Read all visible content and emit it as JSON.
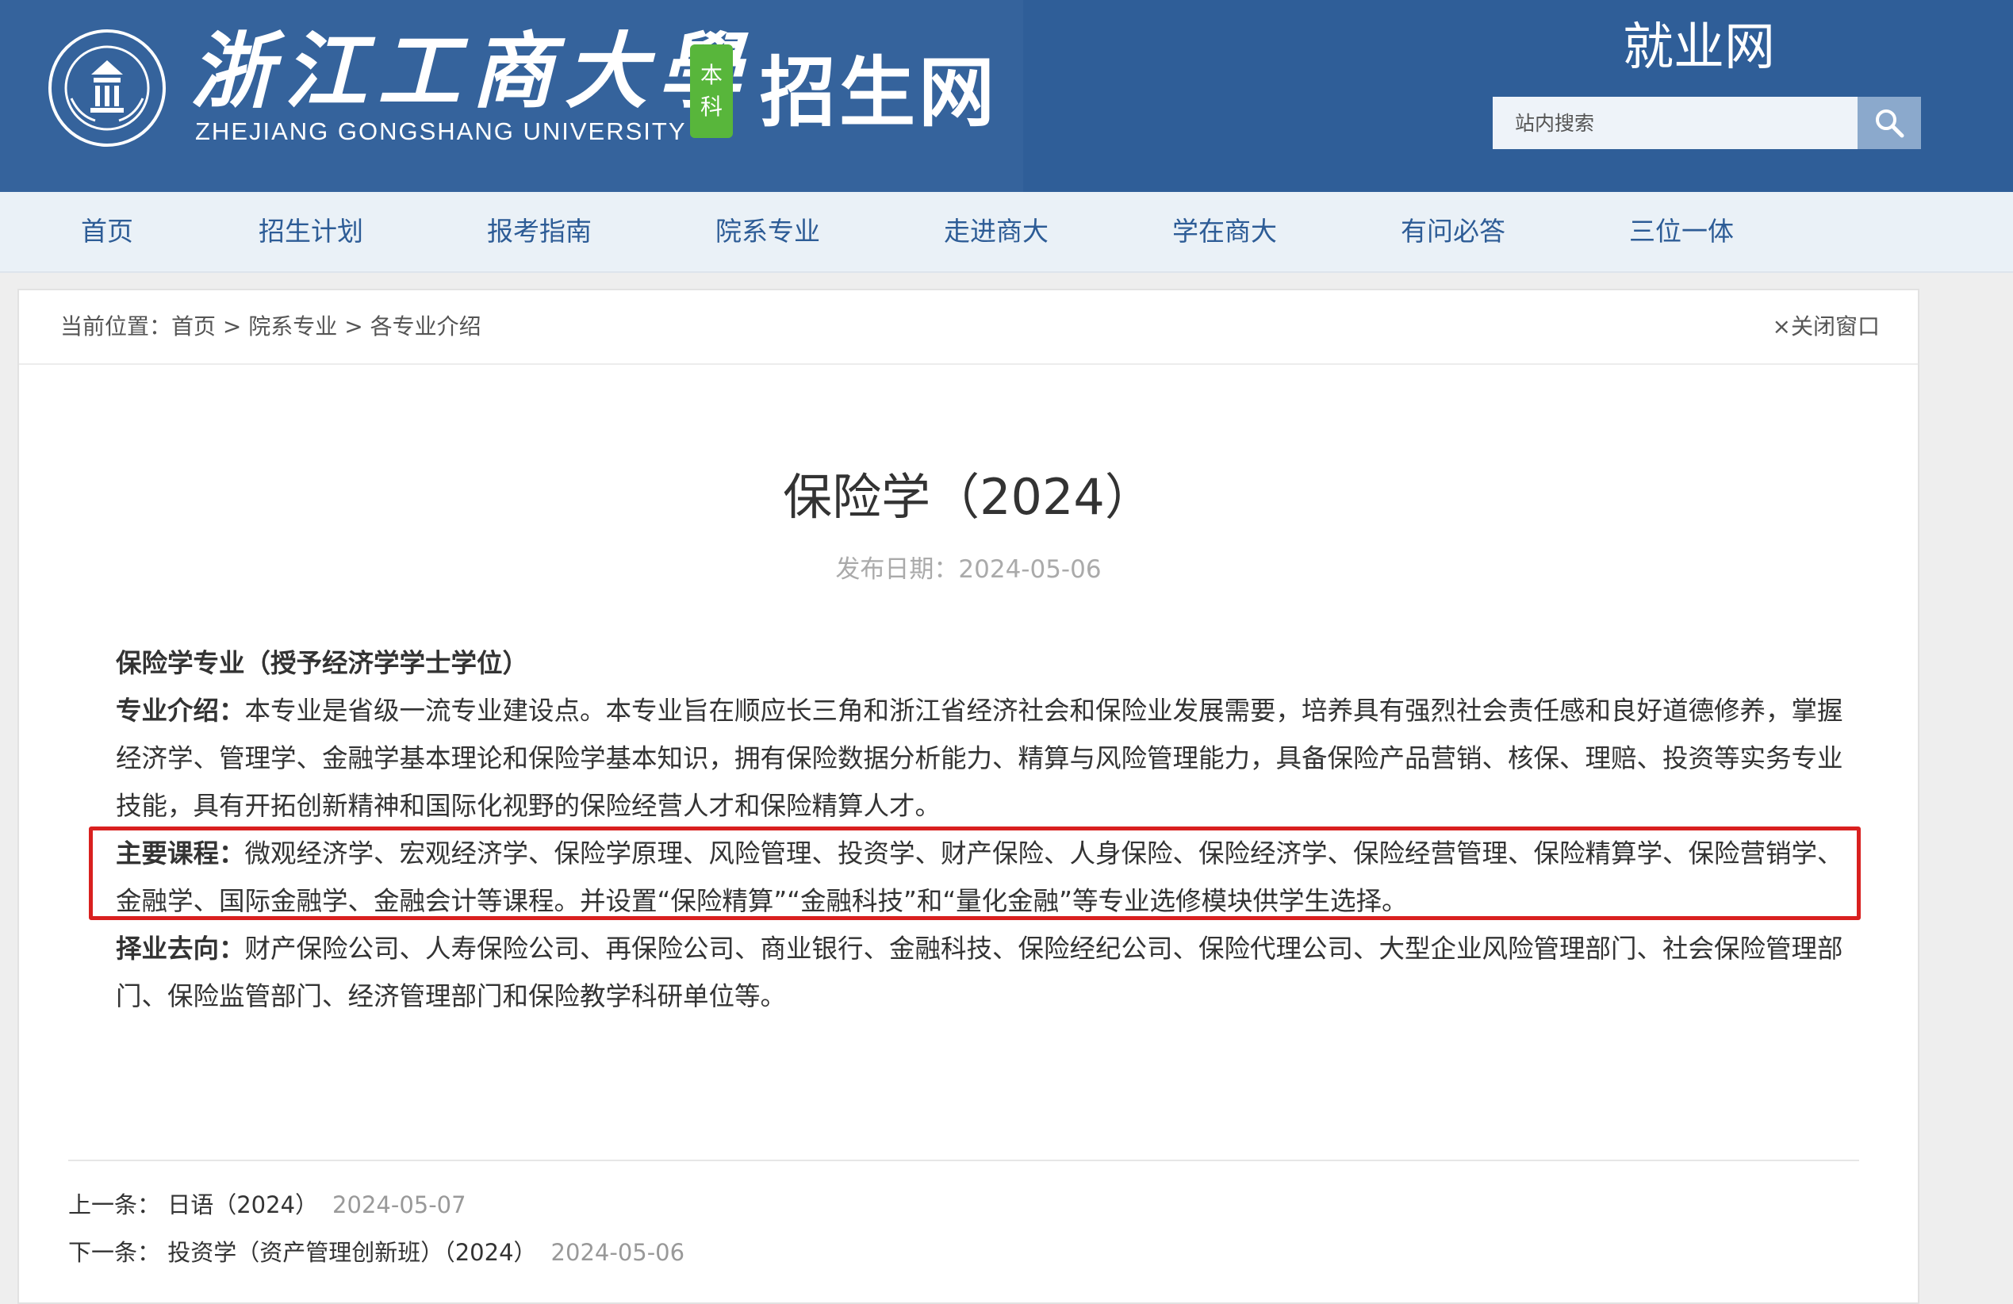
{
  "header": {
    "university_cn": "浙江工商大學",
    "university_en": "ZHEJIANG GONGSHANG UNIVERSITY",
    "badge": [
      "本",
      "科"
    ],
    "site_name": "招生网",
    "employment_link": "就业网",
    "search_placeholder": "站内搜索",
    "emblem_icon": "university-emblem-icon",
    "search_icon": "search-icon"
  },
  "nav": {
    "items": [
      "首页",
      "招生计划",
      "报考指南",
      "院系专业",
      "走进商大",
      "学在商大",
      "有问必答",
      "三位一体"
    ]
  },
  "breadcrumb": {
    "prefix": "当前位置：",
    "items": [
      "首页",
      "院系专业",
      "各专业介绍"
    ],
    "separator": " > "
  },
  "close_window": "×关闭窗口",
  "article": {
    "title": "保险学（2024）",
    "date": "发布日期：2024-05-06",
    "heading": "保险学专业（授予经济学学士学位）",
    "intro_label": "专业介绍：",
    "intro_text": "本专业是省级一流专业建设点。本专业旨在顺应长三角和浙江省经济社会和保险业发展需要，培养具有强烈社会责任感和良好道德修养，掌握经济学、管理学、金融学基本理论和保险学基本知识，拥有保险数据分析能力、精算与风险管理能力，具备保险产品营销、核保、理赔、投资等实务专业技能，具有开拓创新精神和国际化视野的保险经营人才和保险精算人才。",
    "courses_label": "主要课程：",
    "courses_text": "微观经济学、宏观经济学、保险学原理、风险管理、投资学、财产保险、人身保险、保险经济学、保险经营管理、保险精算学、保险营销学、金融学、国际金融学、金融会计等课程。并设置“保险精算”“金融科技”和“量化金融”等专业选修模块供学生选择。",
    "careers_label": "择业去向：",
    "careers_text": "财产保险公司、人寿保险公司、再保险公司、商业银行、金融科技、保险经纪公司、保险代理公司、大型企业风险管理部门、社会保险管理部门、保险监管部门、经济管理部门和保险教学科研单位等。",
    "highlight_color": "#d9201f"
  },
  "prev": {
    "label": "上一条：",
    "title": "日语（2024）",
    "date": "2024-05-07"
  },
  "next": {
    "label": "下一条：",
    "title": "投资学（资产管理创新班）（2024）",
    "date": "2024-05-06"
  },
  "colors": {
    "header_bg": "#2f5e98",
    "nav_bg": "#eaf1f7",
    "nav_text": "#2d5c96",
    "badge_green": "#58b63b"
  }
}
